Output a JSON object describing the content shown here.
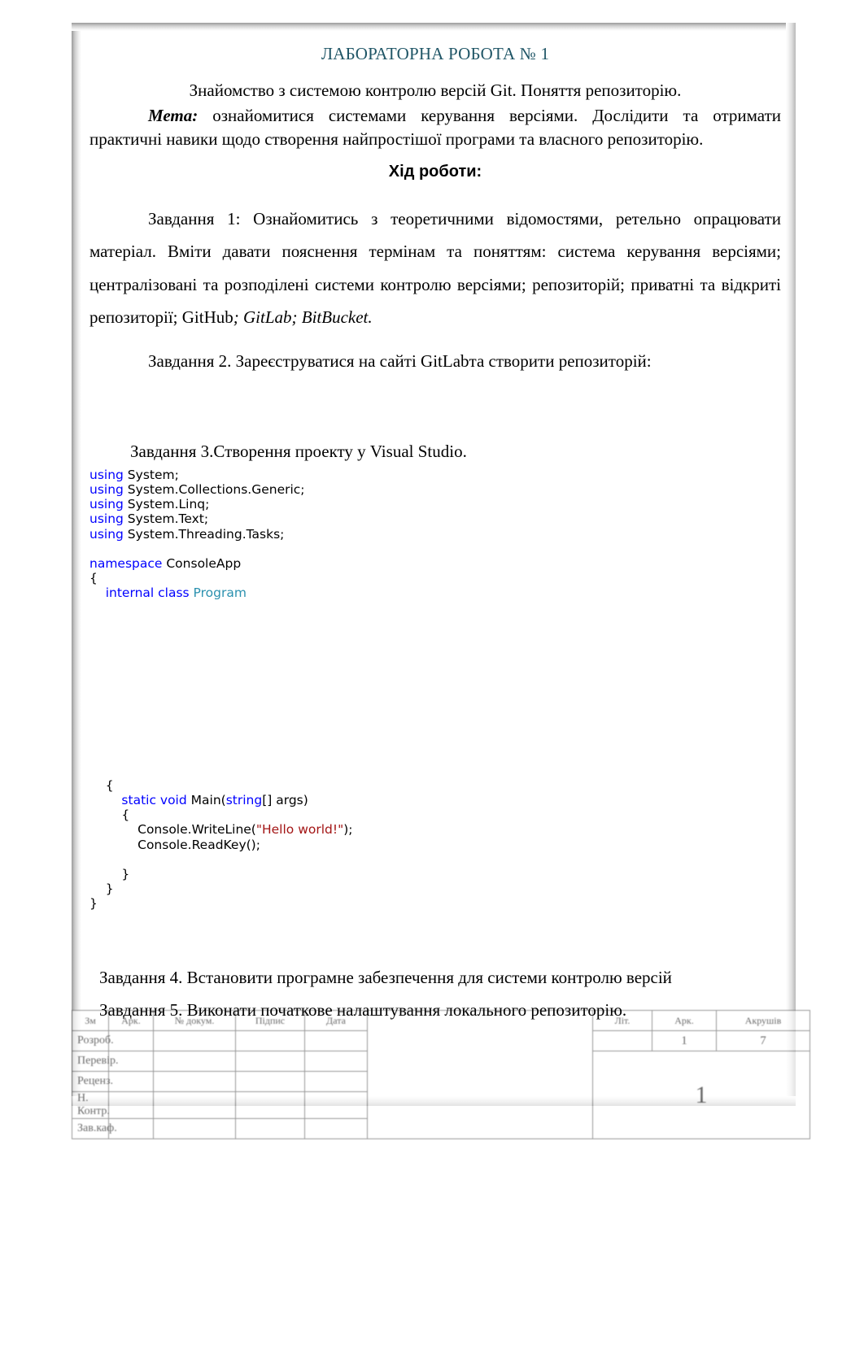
{
  "document": {
    "title": "ЛАБОРАТОРНА РОБОТА № 1",
    "subtitle": "Знайомство з системою контролю версій Git. Поняття репозиторію.",
    "purpose_label": "Мета:",
    "purpose_text": " ознайомитися системами керування версіями. Дослідити та отримати практичні навики щодо створення найпростішої програми та власного репозиторію.",
    "section_heading": "Хід роботи:",
    "tasks": {
      "task1": "Завдання 1: Ознайомитись з теоретичними відомостями, ретельно опрацювати матеріал. Вміти давати пояснення термінам та поняттям: система керування версіями; централізовані та розподілені системи контролю версіями; репозиторій; приватні та відкриті репозиторії; GitHub",
      "task1_tail_italic": "; GitLab; BitBucket.",
      "task2": "Завдання 2. Зареєструватися на сайті GitLabта створити репозиторій:",
      "task3": "Завдання 3.Створення проекту у Visual Studio.",
      "task4": "Завдання 4. Встановити програмне забезпечення для системи контролю версій",
      "task5": "Завдання 5. Виконати початкове налаштування локального репозиторію."
    }
  },
  "code": {
    "language": "csharp",
    "colors": {
      "keyword": "#0000ff",
      "type": "#2b91af",
      "string": "#a31515",
      "plain": "#000000"
    },
    "lines": [
      {
        "id": "l1",
        "kw": "using",
        "rest": " System;"
      },
      {
        "id": "l2",
        "kw": "using",
        "rest": " System.Collections.Generic;"
      },
      {
        "id": "l3",
        "kw": "using",
        "rest": " System.Linq;"
      },
      {
        "id": "l4",
        "kw": "using",
        "rest": " System.Text;"
      },
      {
        "id": "l5",
        "kw": "using",
        "rest": " System.Threading.Tasks;"
      },
      {
        "id": "l6",
        "kw": "",
        "rest": ""
      },
      {
        "id": "l7",
        "kw": "namespace",
        "rest": " ConsoleApp"
      },
      {
        "id": "l8",
        "plain": "{"
      },
      {
        "id": "l9",
        "indent": "    ",
        "kw": "internal class",
        "type": " Program"
      },
      {
        "id": "l10",
        "plain": "    {"
      },
      {
        "id": "l11",
        "indent": "        ",
        "kw": "static void",
        "rest": " Main(",
        "kw2": "string",
        "rest2": "[] args)"
      },
      {
        "id": "l12",
        "plain": "        {"
      },
      {
        "id": "l13",
        "plain": "            Console.WriteLine(",
        "str": "\"Hello world!\"",
        "tail": ");"
      },
      {
        "id": "l14",
        "plain": "            Console.ReadKey();"
      },
      {
        "id": "l15",
        "plain": ""
      },
      {
        "id": "l16",
        "plain": "        }"
      },
      {
        "id": "l17",
        "plain": "    }"
      },
      {
        "id": "l18",
        "plain": "}"
      }
    ],
    "raw": {
      "using1": "using",
      "using1_rest": " System;",
      "using2": "using",
      "using2_rest": " System.Collections.Generic;",
      "using3": "using",
      "using3_rest": " System.Linq;",
      "using4": "using",
      "using4_rest": " System.Text;",
      "using5": "using",
      "using5_rest": " System.Threading.Tasks;",
      "namespace_kw": "namespace",
      "namespace_name": " ConsoleApp",
      "brace_open_ns": "{",
      "class_kw": "internal class",
      "class_name": " Program",
      "brace_open_class": "    {",
      "main_kw": "static void",
      "main_mid": " Main(",
      "main_type": "string",
      "main_tail": "[] args)",
      "brace_open_main": "        {",
      "writeline_head": "            Console.WriteLine(",
      "writeline_str": "\"Hello world!\"",
      "writeline_tail": ");",
      "readkey": "            Console.ReadKey();",
      "brace_close_main": "        }",
      "brace_close_class": "    }",
      "brace_close_ns": "}"
    }
  },
  "stamp": {
    "header": {
      "c1": "Зм",
      "c2": "Арк.",
      "c3": "№ докум.",
      "c4": "Підпис",
      "c5": "Дата"
    },
    "roles": [
      "Розроб.",
      "Перевір.",
      "Реценз.",
      "Н. Контр.",
      "Зав.каф."
    ],
    "right_headers": {
      "lit": "Літ.",
      "ark": "Арк.",
      "arkushiv": "Акрушів"
    },
    "right_values": {
      "ark_value": "1",
      "arkushiv_value": "7"
    },
    "page_number": "1"
  }
}
